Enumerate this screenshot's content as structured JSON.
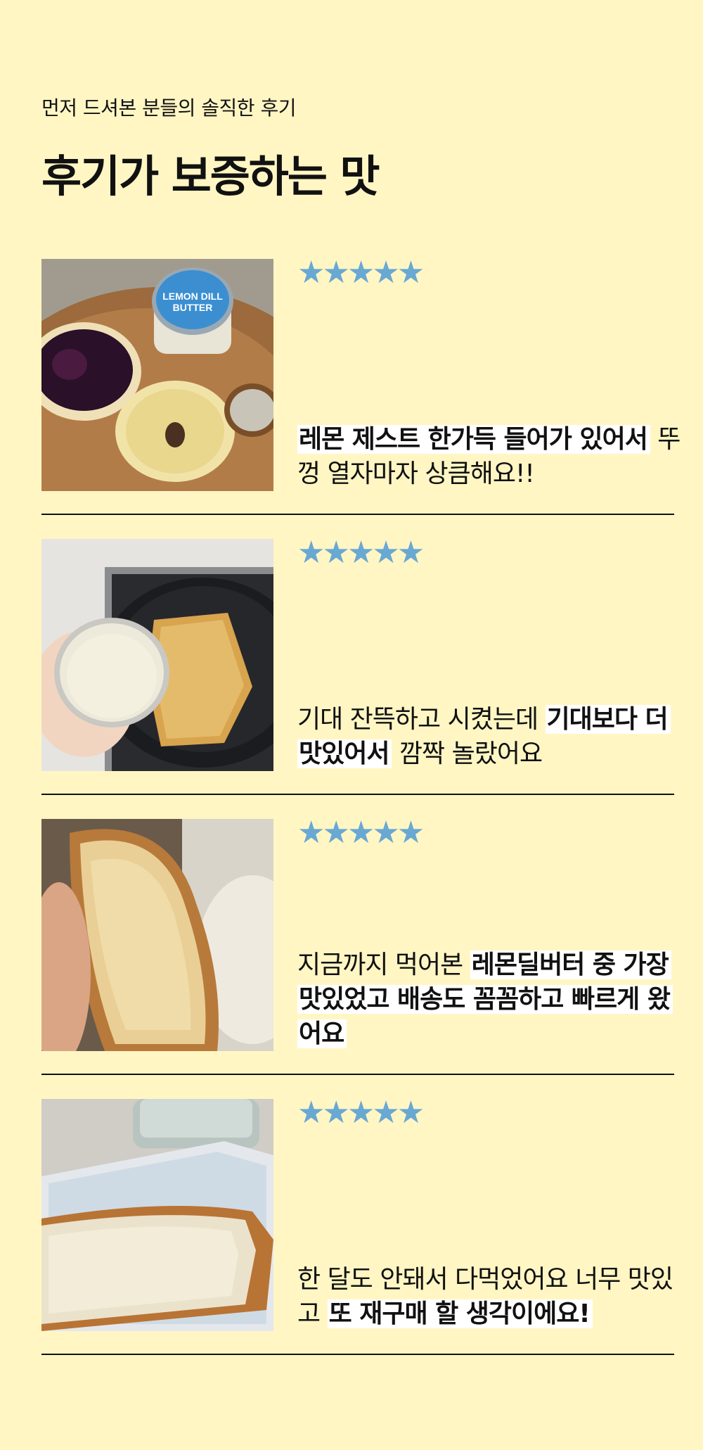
{
  "header": {
    "subtitle": "먼저 드셔본 분들의 솔직한 후기",
    "title": "후기가 보증하는 맛"
  },
  "star_icon": "star-icon",
  "star_color": "#69a8d3",
  "reviews": [
    {
      "rating": "★★★★★",
      "segments": [
        {
          "text": "레몬 제스트 한가득 들어가 있어서",
          "bold": true
        },
        {
          "text": " 뚜껑 열자마자 상큼해요!!",
          "bold": false
        }
      ],
      "jar_label": "LEMON DILL BUTTER"
    },
    {
      "rating": "★★★★★",
      "segments": [
        {
          "text": "기대 잔뜩하고 시켰는데 ",
          "bold": false
        },
        {
          "text": "기대보다 더 맛있어서",
          "bold": true
        },
        {
          "text": " 깜짝 놀랐어요",
          "bold": false
        }
      ]
    },
    {
      "rating": "★★★★★",
      "segments": [
        {
          "text": "지금까지 먹어본 ",
          "bold": false
        },
        {
          "text": "레몬딜버터 중 가장 맛있었고 배송도 꼼꼼하고 빠르게 왔어요",
          "bold": true
        }
      ]
    },
    {
      "rating": "★★★★★",
      "segments": [
        {
          "text": "한 달도 안돼서 다먹었어요 너무 맛있고 ",
          "bold": false
        },
        {
          "text": "또 재구매 할 생각이에요!",
          "bold": true
        }
      ]
    }
  ]
}
